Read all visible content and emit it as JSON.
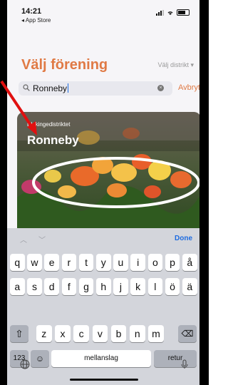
{
  "status": {
    "time": "14:21",
    "back_app": "◂ App Store"
  },
  "header": {
    "title": "Välj förening",
    "district_select": "Välj distrikt ▾"
  },
  "search": {
    "value": "Ronneby",
    "cancel": "Avbryt"
  },
  "card": {
    "subtitle": "Blokingedistriktet",
    "title": "Ronneby"
  },
  "keyboard": {
    "done": "Done",
    "row1": [
      "q",
      "w",
      "e",
      "r",
      "t",
      "y",
      "u",
      "i",
      "o",
      "p",
      "å"
    ],
    "row2": [
      "a",
      "s",
      "d",
      "f",
      "g",
      "h",
      "j",
      "k",
      "l",
      "ö",
      "ä"
    ],
    "row3": [
      "z",
      "x",
      "c",
      "v",
      "b",
      "n",
      "m"
    ],
    "numbers": "123",
    "space": "mellanslag",
    "return": "retur"
  },
  "colors": {
    "accent": "#e07a45",
    "link": "#1d6be0",
    "annotation": "#e01010"
  }
}
